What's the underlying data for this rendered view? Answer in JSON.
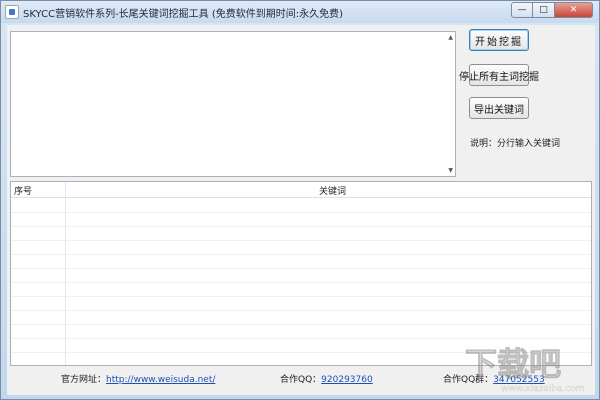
{
  "window": {
    "title": "SKYCC营销软件系列-长尾关键词挖掘工具 (免费软件到期时间:永久免费)",
    "minimize": "—",
    "maximize": "□",
    "close": "✕"
  },
  "controls": {
    "start_label": "开始挖掘",
    "stop_label": "停止所有主词挖掘",
    "export_label": "导出关键词",
    "note": "说明：分行输入关键词"
  },
  "results": {
    "columns": [
      "序号",
      "关键词"
    ],
    "rows": []
  },
  "footer": {
    "site_label": "官方网址：",
    "site_link": "http://www.weisuda.net/",
    "qq_label": "合作QQ：",
    "qq_value": "920293760",
    "group_label": "合作QQ群：",
    "group_value": "347052553"
  },
  "watermark": {
    "text": "下载吧",
    "sub": "www.xiazaiba.com"
  },
  "colors": {
    "frame": "#c9ddf0",
    "client": "#f0f0f0",
    "link": "#1f4fb4",
    "close_button": "#c8473a"
  }
}
